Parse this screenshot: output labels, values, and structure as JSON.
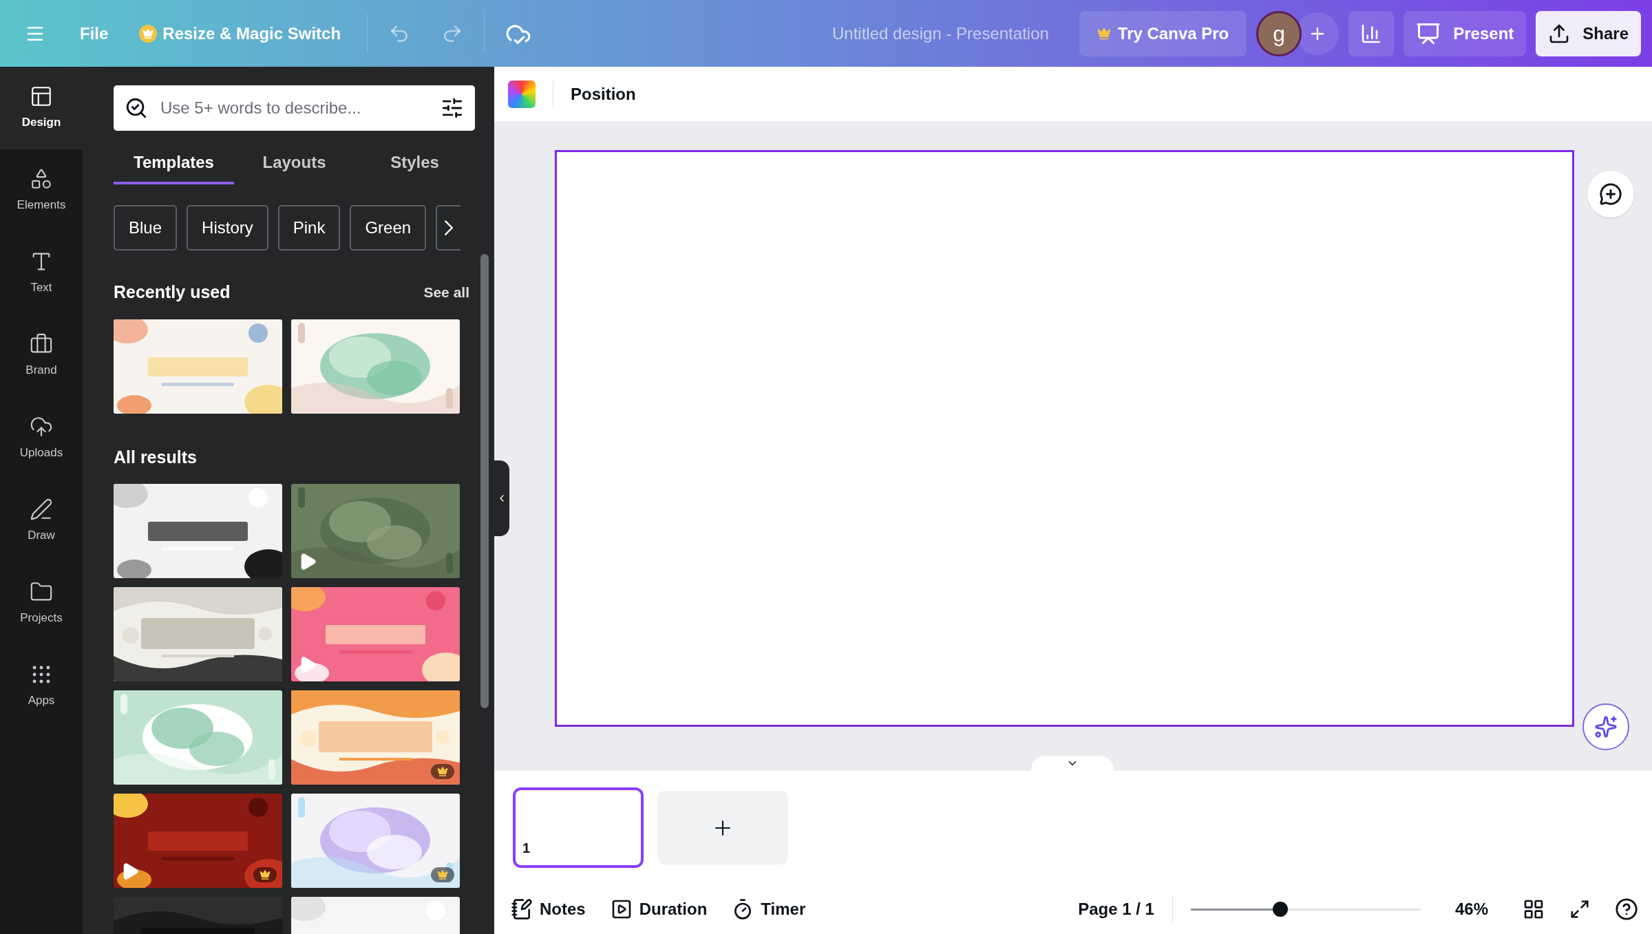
{
  "top_bar": {
    "file": "File",
    "resize": "Resize & Magic Switch",
    "title": "Untitled design - Presentation",
    "try_pro": "Try Canva Pro",
    "avatar": "g",
    "present": "Present",
    "share": "Share"
  },
  "rail": [
    {
      "label": "Design",
      "selected": true
    },
    {
      "label": "Elements",
      "selected": false
    },
    {
      "label": "Text",
      "selected": false
    },
    {
      "label": "Brand",
      "selected": false
    },
    {
      "label": "Uploads",
      "selected": false
    },
    {
      "label": "Draw",
      "selected": false
    },
    {
      "label": "Projects",
      "selected": false
    },
    {
      "label": "Apps",
      "selected": false
    }
  ],
  "search": {
    "placeholder": "Use 5+ words to describe..."
  },
  "tabs": [
    {
      "label": "Templates",
      "selected": true
    },
    {
      "label": "Layouts",
      "selected": false
    },
    {
      "label": "Styles",
      "selected": false
    }
  ],
  "chips": [
    "Blue",
    "History",
    "Pink",
    "Green"
  ],
  "recently_used": {
    "heading": "Recently used",
    "see_all": "See all",
    "templates": [
      {
        "kind": "picture",
        "video": false,
        "pro": false
      },
      {
        "kind": "picture",
        "video": false,
        "pro": false
      }
    ]
  },
  "all_results": {
    "heading": "All results",
    "templates": [
      {
        "kind": "picture",
        "video": false,
        "pro": false
      },
      {
        "kind": "picture",
        "video": true,
        "pro": false
      },
      {
        "kind": "picture",
        "video": false,
        "pro": false
      },
      {
        "kind": "picture",
        "video": true,
        "pro": false
      },
      {
        "kind": "picture",
        "video": false,
        "pro": false
      },
      {
        "kind": "picture",
        "video": false,
        "pro": true
      },
      {
        "kind": "picture",
        "video": true,
        "pro": true
      },
      {
        "kind": "picture",
        "video": false,
        "pro": true
      },
      {
        "kind": "picture"
      },
      {
        "kind": "picture"
      }
    ]
  },
  "canvas_toolbar": {
    "position": "Position"
  },
  "pages": [
    {
      "number": "1",
      "selected": true
    }
  ],
  "bottom_bar": {
    "notes": "Notes",
    "duration": "Duration",
    "timer": "Timer",
    "page": "Page 1 / 1",
    "zoom": {
      "level": 0.39
    },
    "zoom_reading": "46%"
  }
}
